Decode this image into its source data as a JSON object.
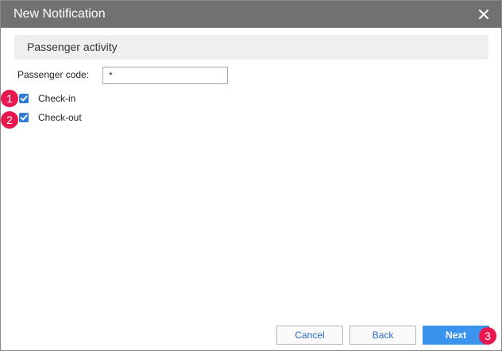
{
  "dialog": {
    "title": "New Notification",
    "close_icon": "close-icon",
    "section_label": "Passenger activity",
    "passenger_code": {
      "label": "Passenger code:",
      "value": "*"
    },
    "checkboxes": [
      {
        "label": "Check-in",
        "checked": true
      },
      {
        "label": "Check-out",
        "checked": true
      }
    ],
    "buttons": {
      "cancel": "Cancel",
      "back": "Back",
      "next": "Next"
    },
    "badges": [
      "1",
      "2",
      "3"
    ]
  },
  "colors": {
    "titlebar": "#717171",
    "checkbox": "#2f7bd6",
    "primary_button": "#3a93ec",
    "badge": "#e8174f",
    "link_text": "#2a6ac8"
  }
}
